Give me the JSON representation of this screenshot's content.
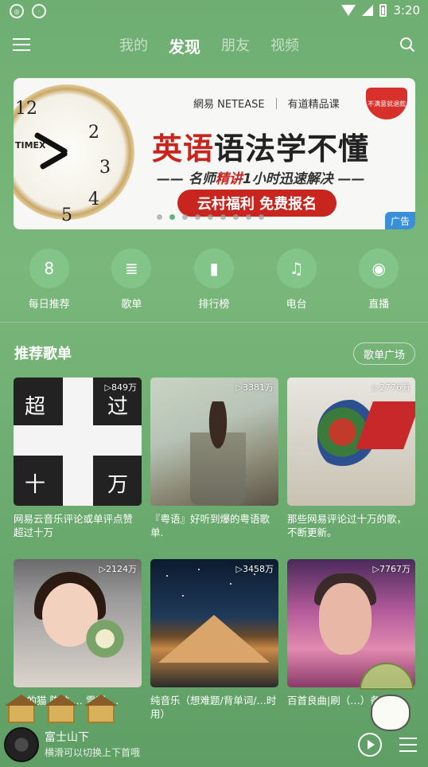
{
  "status": {
    "time": "3:20"
  },
  "nav": {
    "tabs": [
      "我的",
      "发现",
      "朋友",
      "视频"
    ],
    "active_tab": "发现"
  },
  "banner": {
    "logo1": "網易 NETEASE",
    "logo2": "有道精品课",
    "title_a": "英语",
    "title_b": "语法",
    "title_c": "学不懂",
    "sub_a": "—— 名师",
    "sub_b": "精讲",
    "sub_c": "1小时迅速解决 ——",
    "cta": "云村福利 免费报名",
    "shield": "不满意就退款",
    "ad": "广告",
    "clock_brand": "TIMEX",
    "clock_nums": [
      "12",
      "2",
      "3",
      "4",
      "5"
    ]
  },
  "shortcuts": [
    {
      "label": "每日推荐",
      "icon": "calendar-icon",
      "glyph": "8"
    },
    {
      "label": "歌单",
      "icon": "playlist-icon",
      "glyph": "≣"
    },
    {
      "label": "排行榜",
      "icon": "chart-icon",
      "glyph": "▮"
    },
    {
      "label": "电台",
      "icon": "radio-icon",
      "glyph": "♫"
    },
    {
      "label": "直播",
      "icon": "live-icon",
      "glyph": "◉"
    }
  ],
  "section": {
    "title": "推荐歌单",
    "more": "歌单广场"
  },
  "playlists": [
    {
      "plays": "▷849万",
      "caption": "网易云音乐评论或单评点赞超过十万",
      "cover_text": [
        "超",
        "过",
        "十",
        "万"
      ]
    },
    {
      "plays": "▷3381万",
      "caption": "『粤语』好听到爆的粤语歌单."
    },
    {
      "plays": "▷2776万",
      "caption": "那些网易评论过十万的歌，不断更新。"
    },
    {
      "plays": "▷2124万",
      "caption": "… 的猫 陈粒 … 雪凝 …"
    },
    {
      "plays": "▷3458万",
      "caption": "纯音乐（想难题/背单词/…时用）"
    },
    {
      "plays": "▷7767万",
      "caption": "百首良曲|刷（…）备燃曲"
    }
  ],
  "player": {
    "title": "富士山下",
    "subtitle": "横滑可以切换上下首哦"
  }
}
